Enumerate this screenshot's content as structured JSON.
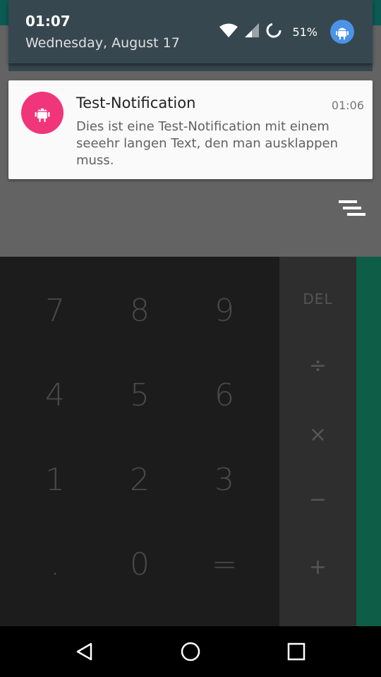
{
  "status": {
    "time": "01:07",
    "date": "Wednesday, August 17",
    "battery": "51%",
    "icons": [
      "wifi-icon",
      "signal-icon",
      "battery-saver-icon",
      "user-avatar-icon"
    ]
  },
  "notification": {
    "title": "Test-Notification",
    "time": "01:06",
    "text": "Dies ist eine Test-Notification mit einem seeehr langen Text, den man ausklappen muss.",
    "icon": "android-icon",
    "accent": "#f0357a"
  },
  "calculator": {
    "keys": [
      "7",
      "8",
      "9",
      "4",
      "5",
      "6",
      "1",
      "2",
      "3",
      ".",
      "0",
      "="
    ],
    "ops": [
      "DEL",
      "÷",
      "×",
      "−",
      "+"
    ]
  },
  "navbar": {
    "buttons": [
      "back-icon",
      "home-icon",
      "recents-icon"
    ]
  },
  "colors": {
    "header": "#37474f",
    "calc_green": "#0d5d47"
  }
}
